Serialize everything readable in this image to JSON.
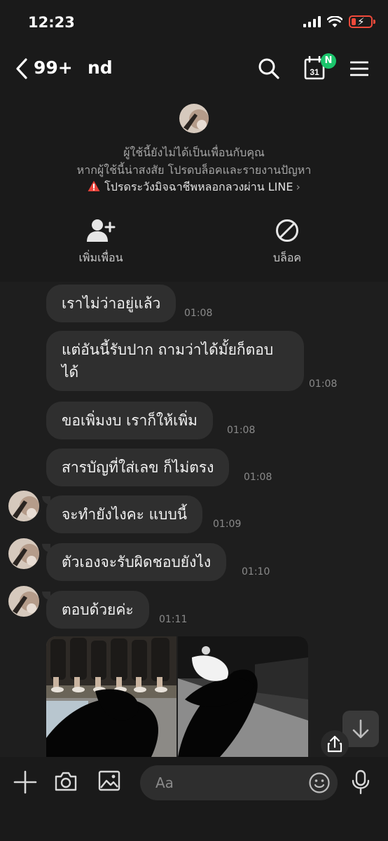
{
  "status": {
    "time": "12:23"
  },
  "header": {
    "unread": "99+",
    "name": "nd",
    "calendar_day": "31",
    "badge": "N"
  },
  "banner": {
    "line1": "ผู้ใช้นี้ยังไม่ได้เป็นเพื่อนกับคุณ",
    "line2": "หากผู้ใช้นี้น่าสงสัย โปรดบล็อคและรายงานปัญหา",
    "warning": "โปรดระวังมิจฉาชีพหลอกลวงผ่าน LINE",
    "add_friend": "เพิ่มเพื่อน",
    "block": "บล็อค"
  },
  "messages": [
    {
      "text": "เราไม่ว่าอยู่แล้ว",
      "time": "01:08"
    },
    {
      "text": "แต่อันนี้รับปาก ถามว่าได้มั้ยก็ตอบได้",
      "time": "01:08"
    },
    {
      "text": "ขอเพิ่มงบ เราก็ให้เพิ่ม",
      "time": "01:08"
    },
    {
      "text": "สารบัญที่ใส่เลข ก็ไม่ตรง",
      "time": "01:08"
    },
    {
      "text": "จะทำยังไงคะ แบบนี้",
      "time": "01:09"
    },
    {
      "text": "ตัวเองจะรับผิดชอบยังไง",
      "time": "01:10"
    },
    {
      "text": "ตอบด้วยค่ะ",
      "time": "01:11"
    }
  ],
  "input": {
    "placeholder": "Aa"
  },
  "icons": {
    "back": "chevron-left-icon",
    "search": "search-icon",
    "calendar": "calendar-icon",
    "menu": "hamburger-menu-icon",
    "add": "plus-icon",
    "camera": "camera-icon",
    "gallery": "image-icon",
    "emoji": "emoji-icon",
    "mic": "microphone-icon",
    "warning": "warning-icon",
    "scroll": "arrow-down-icon",
    "share": "share-icon"
  },
  "colors": {
    "background": "#1e1e1e",
    "bubble": "#2f2f2f",
    "badge": "#1bc46b",
    "warning": "#e8433a",
    "battery": "#f04a3b"
  }
}
